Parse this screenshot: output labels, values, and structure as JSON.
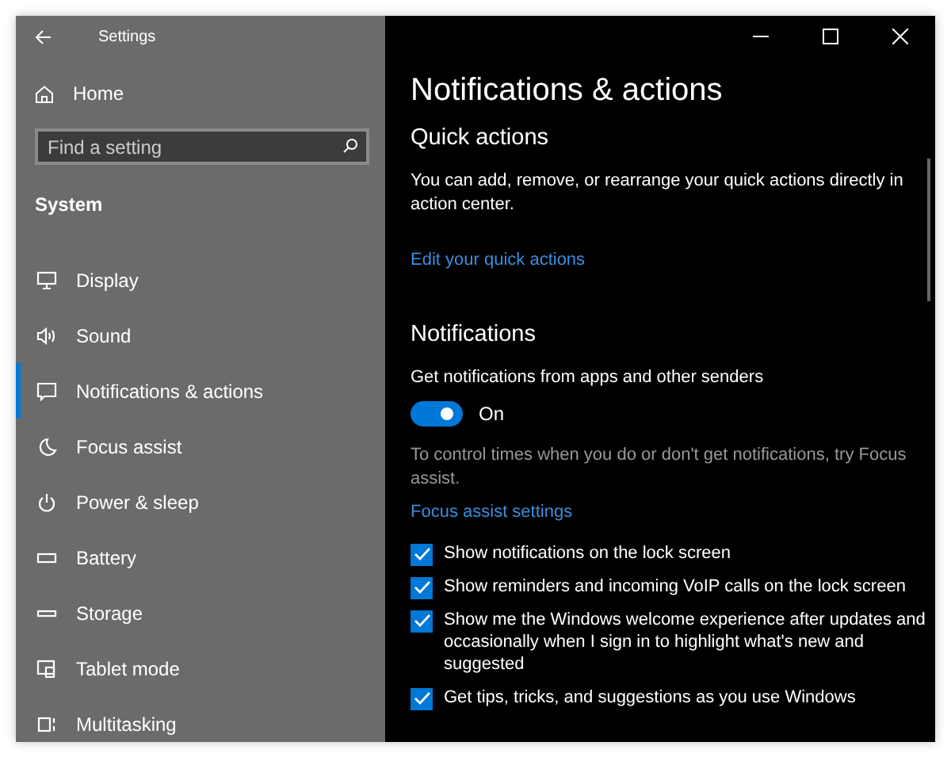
{
  "window": {
    "title": "Settings"
  },
  "sidebar": {
    "home": "Home",
    "search": {
      "placeholder": "Find a setting"
    },
    "section": "System",
    "items": [
      {
        "label": "Display",
        "selected": false
      },
      {
        "label": "Sound",
        "selected": false
      },
      {
        "label": "Notifications & actions",
        "selected": true
      },
      {
        "label": "Focus assist",
        "selected": false
      },
      {
        "label": "Power & sleep",
        "selected": false
      },
      {
        "label": "Battery",
        "selected": false
      },
      {
        "label": "Storage",
        "selected": false
      },
      {
        "label": "Tablet mode",
        "selected": false
      },
      {
        "label": "Multitasking",
        "selected": false
      }
    ]
  },
  "main": {
    "title": "Notifications & actions",
    "quick_actions": {
      "heading": "Quick actions",
      "text": "You can add, remove, or rearrange your quick actions directly in action center.",
      "link": "Edit your quick actions"
    },
    "notifications": {
      "heading": "Notifications",
      "toggle_label": "Get notifications from apps and other senders",
      "toggle": {
        "on": true,
        "text": "On"
      },
      "hint": "To control times when you do or don't get notifications, try Focus assist.",
      "link": "Focus assist settings",
      "options": [
        {
          "label": "Show notifications on the lock screen",
          "checked": true
        },
        {
          "label": "Show reminders and incoming VoIP calls on the lock screen",
          "checked": true
        },
        {
          "label": "Show me the Windows welcome experience after updates and occasionally when I sign in to highlight what's new and suggested",
          "checked": true
        },
        {
          "label": "Get tips, tricks, and suggestions as you use Windows",
          "checked": true
        }
      ]
    }
  }
}
